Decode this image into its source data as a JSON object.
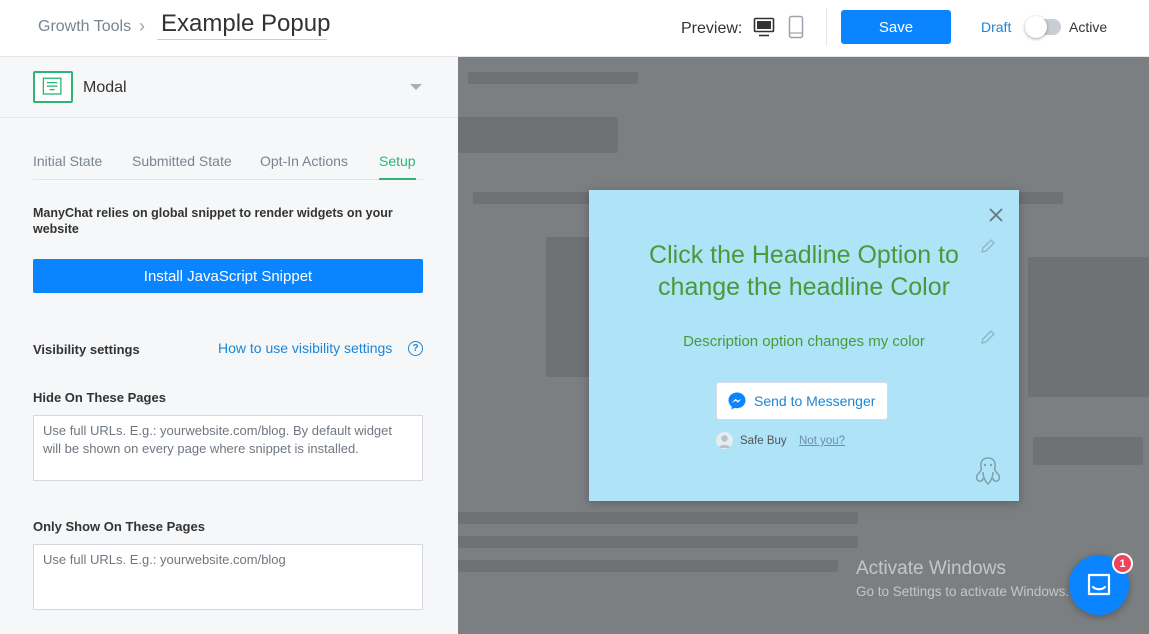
{
  "header": {
    "breadcrumb": "Growth Tools",
    "breadcrumb_sep": "›",
    "title": "Example Popup",
    "preview_label": "Preview:",
    "save_label": "Save",
    "draft_label": "Draft",
    "active_label": "Active",
    "status_active": false,
    "icons": [
      "desktop-icon",
      "mobile-icon"
    ]
  },
  "sidebar": {
    "widget_type": "Modal",
    "tabs": [
      {
        "label": "Initial State",
        "selected": false
      },
      {
        "label": "Submitted State",
        "selected": false
      },
      {
        "label": "Opt-In Actions",
        "selected": false
      },
      {
        "label": "Setup",
        "selected": true
      }
    ],
    "snippet_note": "ManyChat relies on global snippet to render widgets on your website",
    "install_button": "Install JavaScript Snippet",
    "visibility_title": "Visibility settings",
    "visibility_link": "How to use visibility settings",
    "hide_title": "Hide On These Pages",
    "hide_placeholder": "Use full URLs. E.g.: yourwebsite.com/blog. By default widget will be shown on every page where snippet is installed.",
    "only_title": "Only Show On These Pages",
    "only_placeholder": "Use full URLs. E.g.: yourwebsite.com/blog"
  },
  "popup": {
    "headline": "Click the Headline Option to change the headline Color",
    "description": "Description option changes my color",
    "button_label": "Send to Messenger",
    "safe_buy": "Safe Buy",
    "not_you": "Not you?",
    "colors": {
      "background": "#aee3f8",
      "headline": "#4a9a3a",
      "accent": "#0a84ff"
    }
  },
  "watermark": {
    "title": "Activate Windows",
    "subtitle": "Go to Settings to activate Windows."
  },
  "chat": {
    "badge_count": "1"
  }
}
